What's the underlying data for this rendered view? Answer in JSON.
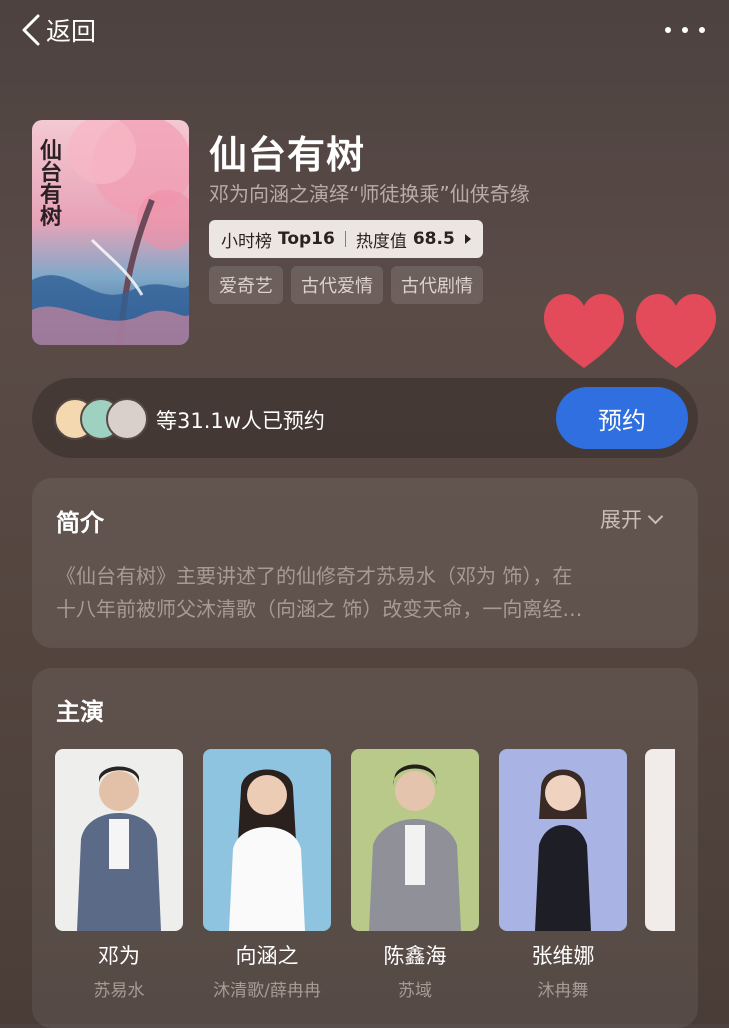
{
  "nav": {
    "back_label": "返回"
  },
  "show": {
    "title": "仙台有树",
    "subtitle": "邓为向涵之演绎“师徒换乘”仙侠奇缘",
    "poster_text": "仙台有树",
    "rank": {
      "board": "小时榜",
      "position": "Top16",
      "heat_label": "热度值",
      "heat_value": "68.5"
    },
    "tags": [
      "爱奇艺",
      "古代爱情",
      "古代剧情"
    ]
  },
  "reserve": {
    "count_text": "等31.1w人已预约",
    "button_label": "预约"
  },
  "intro": {
    "title": "简介",
    "expand_label": "展开",
    "lines": [
      "《仙台有树》主要讲述了的仙修奇才苏易水（邓为 饰），在",
      "十八年前被师父沐清歌（向涵之 饰）改变天命，一向离经…"
    ]
  },
  "cast": {
    "title": "主演",
    "members": [
      {
        "name": "邓为",
        "role": "苏易水"
      },
      {
        "name": "向涵之",
        "role": "沐清歌/薛冉冉"
      },
      {
        "name": "陈鑫海",
        "role": "苏域"
      },
      {
        "name": "张维娜",
        "role": "沐冉舞"
      },
      {
        "name": "",
        "role": ""
      }
    ]
  },
  "colors": {
    "accent": "#2f6fe0",
    "heart": "#e44b5a"
  }
}
